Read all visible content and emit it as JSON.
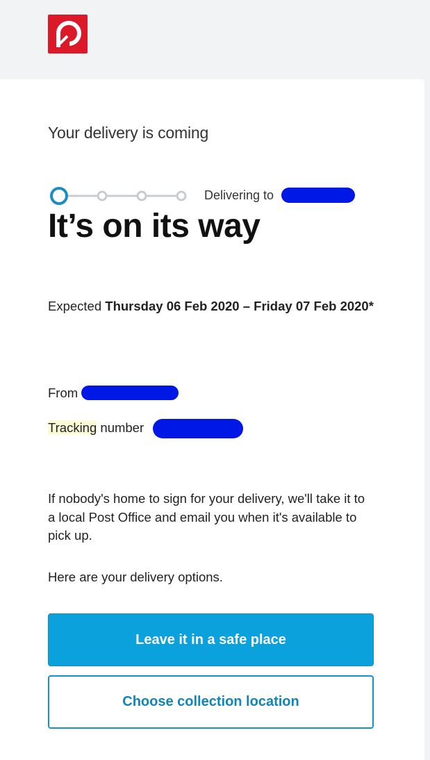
{
  "header": {
    "logo_icon": "australia-post-logo-icon",
    "brand_color": "#dc1928"
  },
  "email": {
    "subtitle": "Your delivery is coming",
    "progress": {
      "current_step": 1,
      "total_steps": 4,
      "active_color": "#1a8ec4",
      "inactive_color": "#c8ccd1"
    },
    "delivering_to_label": "Delivering to",
    "headline": "It’s on its way",
    "expected_label": "Expected",
    "expected_dates": "Thursday 06 Feb 2020 – Friday 07 Feb 2020*",
    "from_label": "From",
    "tracking_label": "Tracking",
    "tracking_suffix": " number",
    "info_text": "If nobody's home to sign for your delivery, we'll take it to a local Post Office and email you when it's available to pick up.",
    "options_text": "Here are your delivery options.",
    "primary_button": "Leave it in a safe place",
    "secondary_button": "Choose collection location",
    "accent_color": "#0aa1dc",
    "redaction_color": "#0018e6"
  }
}
